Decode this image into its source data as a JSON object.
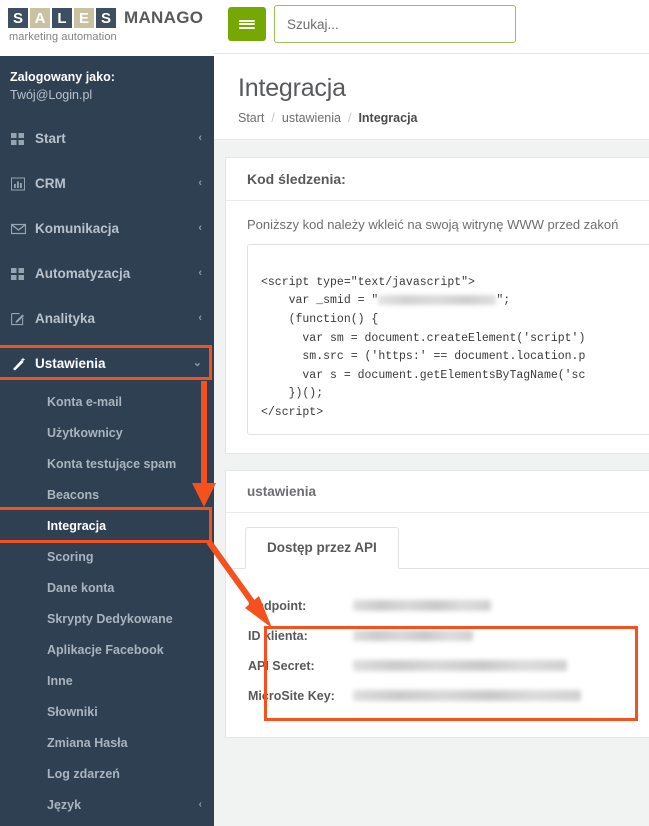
{
  "brand": {
    "letters": [
      "S",
      "A",
      "L",
      "E",
      "S"
    ],
    "name": "MANAGO",
    "tagline": "marketing automation"
  },
  "account": {
    "logged_in_label": "Zalogowany jako:",
    "user": "Twój@Login.pl"
  },
  "sidebar": {
    "nav": [
      {
        "label": "Start",
        "icon": "grid-icon",
        "caret": "‹"
      },
      {
        "label": "CRM",
        "icon": "bar-chart-icon",
        "caret": "‹"
      },
      {
        "label": "Komunikacja",
        "icon": "envelope-icon",
        "caret": "‹"
      },
      {
        "label": "Automatyzacja",
        "icon": "grid-icon",
        "caret": "‹"
      },
      {
        "label": "Analityka",
        "icon": "pencil-square-icon",
        "caret": "‹"
      },
      {
        "label": "Ustawienia",
        "icon": "magic-wand-icon",
        "caret": "⌄"
      }
    ],
    "submenu": [
      {
        "label": "Konta e-mail"
      },
      {
        "label": "Użytkownicy"
      },
      {
        "label": "Konta testujące spam"
      },
      {
        "label": "Beacons"
      },
      {
        "label": "Integracja"
      },
      {
        "label": "Scoring"
      },
      {
        "label": "Dane konta"
      },
      {
        "label": "Skrypty Dedykowane"
      },
      {
        "label": "Aplikacje Facebook"
      },
      {
        "label": "Inne"
      },
      {
        "label": "Słowniki"
      },
      {
        "label": "Zmiana Hasła"
      },
      {
        "label": "Log zdarzeń"
      },
      {
        "label": "Język",
        "caret": "‹"
      }
    ]
  },
  "topbar": {
    "menu_toggle_name": "hamburger-icon",
    "search_placeholder": "Szukaj..."
  },
  "page": {
    "title": "Integracja",
    "breadcrumb": [
      {
        "label": "Start"
      },
      {
        "label": "ustawienia"
      },
      {
        "label": "Integracja"
      }
    ],
    "breadcrumb_separator": "/"
  },
  "tracking_panel": {
    "header": "Kod śledzenia:",
    "note": "Poniższy kod należy wkleić na swoją witrynę WWW przed zakoń",
    "code_lines": [
      {
        "text": "<script type=\"text/javascript\">"
      },
      {
        "text": "    var _smid = \"",
        "redacted": true,
        "redacted_width": 118,
        "after": "\";"
      },
      {
        "text": "    (function() {"
      },
      {
        "text": "      var sm = document.createElement('script')"
      },
      {
        "text": "      sm.src = ('https:' == document.location.p"
      },
      {
        "text": "      var s = document.getElementsByTagName('sc"
      },
      {
        "text": "    })();"
      },
      {
        "text": "</script>"
      }
    ]
  },
  "settings_panel": {
    "header": "ustawienia",
    "tabs": [
      {
        "label": "Dostęp przez API",
        "active": true
      }
    ],
    "credentials": [
      {
        "label": "Endpoint:",
        "value_redacted": true,
        "value_width": 138
      },
      {
        "label": "ID klienta:",
        "value_redacted": true,
        "value_width": 120
      },
      {
        "label": "API Secret:",
        "value_redacted": true,
        "value_width": 214
      },
      {
        "label": "MicroSite Key:",
        "value_redacted": true,
        "value_width": 228
      }
    ]
  },
  "annotations": {
    "highlight_color": "#f4511e",
    "boxes": [
      {
        "name": "ustawienia-highlight"
      },
      {
        "name": "integracja-highlight"
      },
      {
        "name": "api-credentials-highlight"
      }
    ],
    "arrows": [
      {
        "name": "arrow-ustawienia-to-integracja"
      },
      {
        "name": "arrow-integracja-to-credentials"
      }
    ]
  }
}
